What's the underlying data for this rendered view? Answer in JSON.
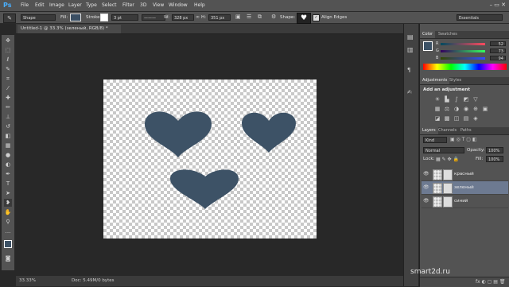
{
  "app": {
    "logo": "Ps"
  },
  "menu": [
    "File",
    "Edit",
    "Image",
    "Layer",
    "Type",
    "Select",
    "Filter",
    "3D",
    "View",
    "Window",
    "Help"
  ],
  "window_controls": "–  ▭  ✕",
  "options_bar": {
    "tool_mode": "Shape",
    "fill_label": "Fill:",
    "stroke_label": "Stroke:",
    "stroke_width": "3 pt",
    "width_label": "W:",
    "width_value": "328 px",
    "height_label": "H:",
    "height_value": "351 px",
    "shape_label": "Shape:",
    "align_edges": "Align Edges",
    "workspace": "Essentials",
    "fill_color": "#3a4e63"
  },
  "document": {
    "tab_title": "Untitled-1 @ 33.3% (зеленый, RGB/8) *",
    "shape_color": "#3d5266"
  },
  "status": {
    "zoom": "33.33%",
    "doc_info": "Doc: 5.49M/0 bytes"
  },
  "color_panel": {
    "tabs": [
      "Color",
      "Swatches"
    ],
    "r_label": "R",
    "r_value": "52",
    "g_label": "G",
    "g_value": "73",
    "b_label": "B",
    "b_value": "94"
  },
  "adjustments_panel": {
    "tabs": [
      "Adjustments",
      "Styles"
    ],
    "title": "Add an adjustment"
  },
  "layers_panel": {
    "tabs": [
      "Layers",
      "Channels",
      "Paths"
    ],
    "kind": "Kind",
    "blend_mode": "Normal",
    "opacity_label": "Opacity:",
    "opacity_value": "100%",
    "lock_label": "Lock:",
    "fill_label": "Fill:",
    "fill_value": "100%",
    "layers": [
      "красный",
      "зеленый",
      "синий"
    ],
    "selected_layer": "зеленый"
  },
  "watermark": "smart2d.ru"
}
